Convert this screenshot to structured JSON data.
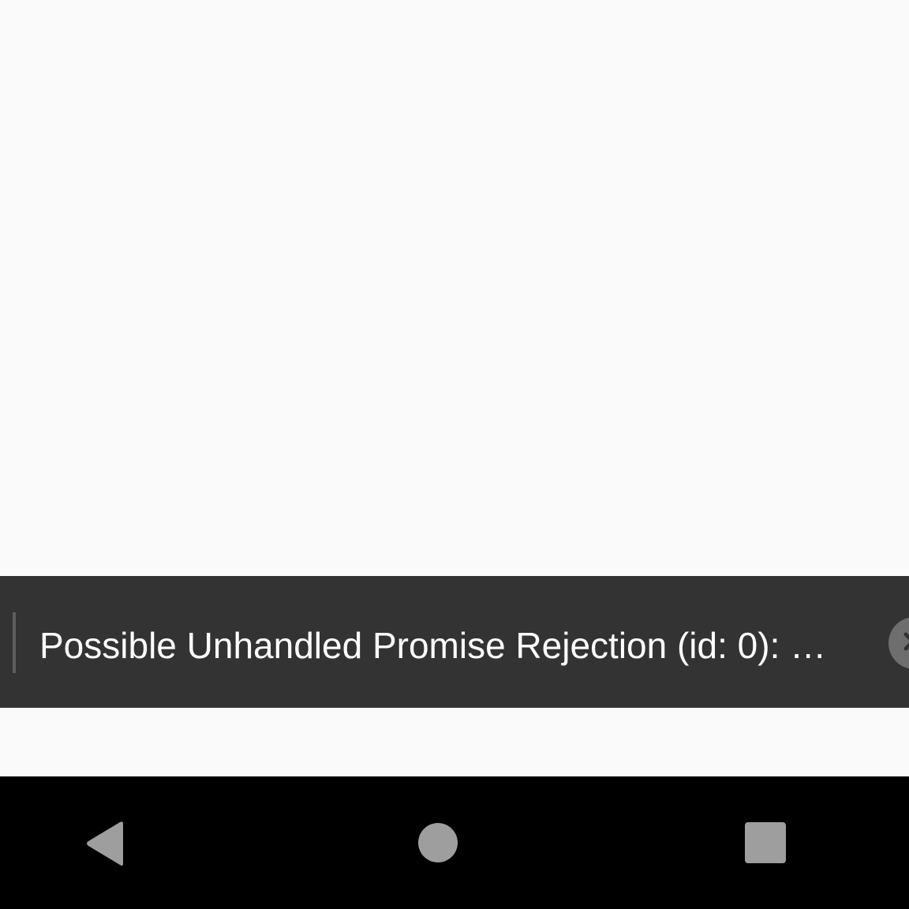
{
  "warning": {
    "message": "Possible Unhandled Promise Rejection (id: 0): …"
  },
  "icons": {
    "dismiss": "close-icon",
    "back": "back-triangle-icon",
    "home": "home-circle-icon",
    "recents": "recents-square-icon"
  },
  "colors": {
    "background": "#fafafa",
    "banner": "#333333",
    "banner_accent": "#5e5e5e",
    "dismiss": "#6e6e6e",
    "nav_bar": "#000000",
    "nav_icon": "#9e9e9e",
    "text": "#ffffff"
  }
}
